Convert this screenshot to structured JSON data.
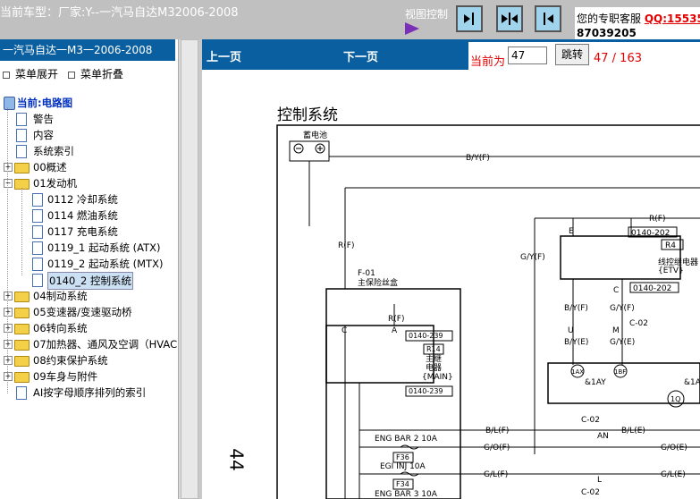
{
  "header": {
    "car_title": "当前车型：厂家:Y--一汽马自达M32006-2008",
    "view_control": "视图控制",
    "service_label": "您的专职客服",
    "qq_label": "QQ:15535",
    "qq_number": "87039205",
    "buttons": [
      "show-sidebar",
      "split-view",
      "hide-sidebar"
    ]
  },
  "sidebar": {
    "title": "一汽马自达一M3一2006-2008",
    "expand": "菜单展开",
    "collapse": "菜单折叠",
    "root": "当前:电路图",
    "items": [
      {
        "label": "警告",
        "type": "doc",
        "level": 1
      },
      {
        "label": "内容",
        "type": "doc",
        "level": 1
      },
      {
        "label": "系统索引",
        "type": "doc",
        "level": 1
      },
      {
        "label": "00概述",
        "type": "folder",
        "level": 1
      },
      {
        "label": "01发动机",
        "type": "folder-open",
        "level": 1
      },
      {
        "label": "0112 冷却系统",
        "type": "doc",
        "level": 2
      },
      {
        "label": "0114 燃油系统",
        "type": "doc",
        "level": 2
      },
      {
        "label": "0117 充电系统",
        "type": "doc",
        "level": 2
      },
      {
        "label": "0119_1 起动系统 (ATX)",
        "type": "doc",
        "level": 2
      },
      {
        "label": "0119_2 起动系统 (MTX)",
        "type": "doc",
        "level": 2
      },
      {
        "label": "0140_2 控制系统",
        "type": "doc",
        "level": 2,
        "selected": true
      },
      {
        "label": "04制动系统",
        "type": "folder",
        "level": 1
      },
      {
        "label": "05变速器/变速驱动桥",
        "type": "folder",
        "level": 1
      },
      {
        "label": "06转向系统",
        "type": "folder",
        "level": 1
      },
      {
        "label": "07加热器、通风及空调（HVAC",
        "type": "folder",
        "level": 1
      },
      {
        "label": "08约束保护系统",
        "type": "folder",
        "level": 1
      },
      {
        "label": "09车身与附件",
        "type": "folder",
        "level": 1
      },
      {
        "label": "AI按字母顺序排列的索引",
        "type": "doc",
        "level": 1
      }
    ]
  },
  "nav": {
    "prev": "上一页",
    "next": "下一页",
    "current_label": "当前为",
    "current_page": "47",
    "jump": "跳转",
    "page_count": "47 / 163"
  },
  "document": {
    "title": "控制系统",
    "side_page_number": "44"
  },
  "diagram": {
    "battery": "蓄电池",
    "by_f_top": "B/Y(F)",
    "r_f_left": "R(F)",
    "r_f_right": "R(F)",
    "e_label": "E",
    "ref_0140_202_a": "0140-202",
    "r4": "R4",
    "throttle_relay": "线控继电器",
    "etv": "{ETV}",
    "gy_f_left": "G/Y(F)",
    "c_label_a": "C",
    "ref_0140_202_b": "0140-202",
    "by_f_mid": "B/Y(F)",
    "gy_f_mid": "G/Y(F)",
    "u_label": "U",
    "m_label": "M",
    "c02_a": "C-02",
    "by_e": "B/Y(E)",
    "gy_e": "G/Y(E)",
    "tag_1ax": "1AX",
    "tag_1bf": "1BF",
    "amp1ay": "&1AY",
    "amp1a_right": "&1A",
    "oneq": "1Q",
    "f01": "F-01",
    "main_fuse_box": "主保险丝盒",
    "r_f_inner": "R(F)",
    "c_label_b": "C",
    "a_label": "A",
    "ref_0140_239_a": "0140-239",
    "r14": "R14",
    "main_relay_1": "主继",
    "main_relay_2": "电器",
    "main_tag": "{MAIN}",
    "ref_0140_239_b": "0140-239",
    "bl_f": "B/L(F)",
    "c02_b": "C-02",
    "bl_e": "B/L(E)",
    "an_label": "AN",
    "eng_bar2": "ENG BAR 2 10A",
    "f36": "F36",
    "go_f": "G/O(F)",
    "go_e": "G/O(E)",
    "egi_inj": "EGI INJ 10A",
    "f34": "F34",
    "gl_f": "G/L(F)",
    "gl_e": "G/L(E)",
    "l_label": "L",
    "eng_bar3": "ENG BAR 3 10A",
    "c02_c": "C-02"
  }
}
